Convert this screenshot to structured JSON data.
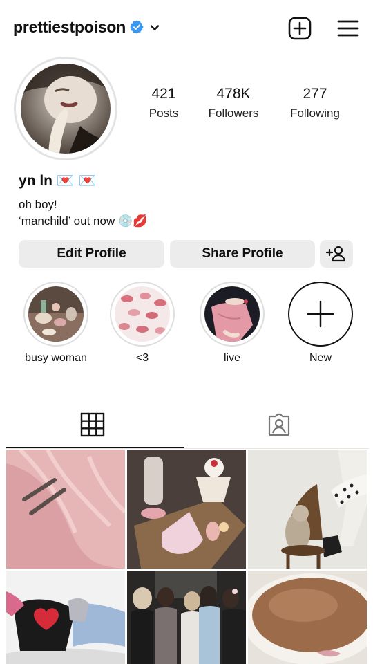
{
  "header": {
    "username": "prettiestpoison",
    "verified_icon": "verified-badge-icon",
    "dropdown_icon": "chevron-down-icon",
    "new_post_icon": "plus-square-icon",
    "menu_icon": "hamburger-menu-icon"
  },
  "profile": {
    "stats": [
      {
        "value": "421",
        "label": "Posts"
      },
      {
        "value": "478K",
        "label": "Followers"
      },
      {
        "value": "277",
        "label": "Following"
      }
    ],
    "name": "yn ln 💌 💌",
    "bio": [
      "oh boy!",
      "‘manchild’ out now 💿💋"
    ]
  },
  "actions": {
    "edit_label": "Edit Profile",
    "share_label": "Share Profile",
    "discover_icon": "add-person-icon"
  },
  "highlights": [
    {
      "label": "busy woman"
    },
    {
      "label": "<3"
    },
    {
      "label": "live"
    },
    {
      "label": "New"
    }
  ],
  "tabs": {
    "grid_icon": "grid-icon",
    "tagged_icon": "tagged-person-icon",
    "active": "grid"
  },
  "colors": {
    "verified_blue": "#3897f0",
    "button_bg": "#ececec",
    "heart_red": "#d93a4a"
  }
}
